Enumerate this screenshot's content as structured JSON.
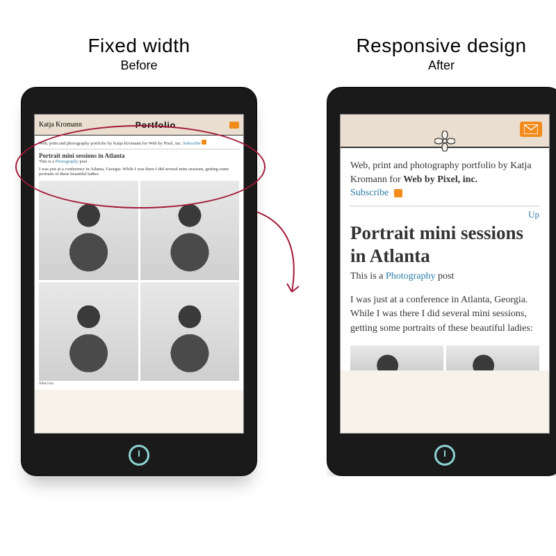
{
  "left": {
    "heading": "Fixed width",
    "subheading": "Before",
    "header_logo": "Katja Kromann",
    "header_title": "Portfolio",
    "intro_line": "Web, print and photography portfolio by Katja Kromann for Web by Pixel, inc.",
    "subscribe": "Subscribe",
    "post_title": "Portrait mini sessions in Atlanta",
    "category_prefix": "This is a",
    "category_link": "Photography",
    "category_suffix": "post",
    "body_text": "I was just at a conference in Atlanta, Georgia. While I was there I did several mini sessions, getting some portraits of these beautiful ladies:",
    "caption": "Nilla Cera"
  },
  "right": {
    "heading": "Responsive design",
    "subheading": "After",
    "intro_prefix": "Web, print and photography portfolio by Katja Kromann for ",
    "company": "Web by Pixel, inc.",
    "subscribe": "Subscribe",
    "up": "Up",
    "post_title": "Portrait mini sessions in Atlanta",
    "category_prefix": "This is a ",
    "category_link": "Photography",
    "category_suffix": " post",
    "body_text": "I was just at a conference in Atlanta, Georgia. While I was there I did several mini sessions, getting some portraits of these beautiful ladies:"
  },
  "annotation": {
    "purpose": "Circle highlights cramped fixed-width header; arrow points to responsive version"
  }
}
